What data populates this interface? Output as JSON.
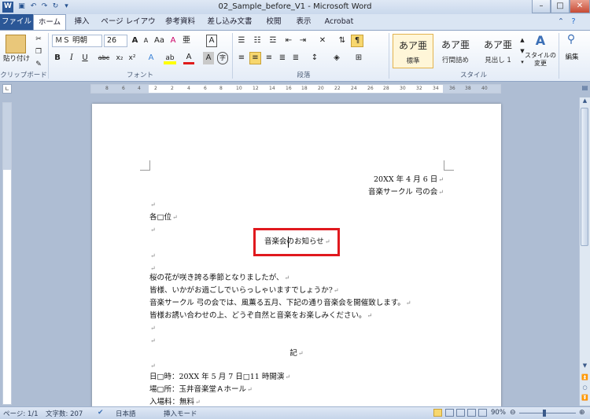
{
  "window": {
    "title": "02_Sample_before_V1 - Microsoft Word",
    "controls": {
      "minimize": "–",
      "maximize": "□",
      "close": "✕"
    },
    "qat_icons": [
      "word-logo-icon",
      "save-icon",
      "undo-icon",
      "redo-icon",
      "customize-qat-icon"
    ]
  },
  "tabs": [
    "ファイル",
    "ホーム",
    "挿入",
    "ページ レイアウト",
    "参考資料",
    "差し込み文書",
    "校閲",
    "表示",
    "Acrobat"
  ],
  "ribbon": {
    "clipboard": {
      "paste_label": "貼り付け",
      "group_label": "クリップボード"
    },
    "font": {
      "font_name": "ＭＳ 明朝",
      "font_size": "26",
      "group_label": "フォント",
      "buttons": [
        "A",
        "A",
        "Aa",
        "A",
        "亜",
        "A",
        "B",
        "I",
        "U",
        "abc",
        "x₂",
        "x²",
        "A",
        "ab",
        "A",
        "A",
        "字"
      ]
    },
    "paragraph": {
      "group_label": "段落"
    },
    "styles": {
      "items": [
        {
          "preview": "あア亜",
          "name": "標準"
        },
        {
          "preview": "あア亜",
          "name": "行間詰め"
        },
        {
          "preview": "あア亜",
          "name": "見出し 1"
        }
      ],
      "change_styles": "スタイルの変更",
      "group_label": "スタイル"
    },
    "editing": {
      "label": "編集"
    }
  },
  "ruler_numbers": [
    "8",
    "6",
    "4",
    "2",
    "2",
    "4",
    "6",
    "8",
    "10",
    "12",
    "14",
    "16",
    "18",
    "20",
    "22",
    "24",
    "26",
    "28",
    "30",
    "32",
    "34",
    "36",
    "38",
    "40"
  ],
  "document": {
    "date": "20XX 年 4 月 6 日",
    "sender": "音楽サークル 弓の会",
    "salutation": "各□位",
    "title": "音楽会のお知らせ",
    "body": [
      "桜の花が咲き誇る季節となりましたが、",
      "皆様、いかがお過ごしでいらっしゃいますでしょうか?",
      "音楽サークル 弓の会では、風薫る五月、下記の通り音楽会を開催致します。",
      "皆様お誘い合わせの上、どうぞ自然と音楽をお楽しみください。"
    ],
    "ki": "記",
    "details": [
      "日□時：20XX 年 5 月 7 日□11 時開演",
      "場□所：玉井音楽堂Ａホール",
      "入場料：無料"
    ],
    "paragraph_mark": "↵",
    "highlight_color": "#e0191e"
  },
  "statusbar": {
    "page": "ページ: 1/1",
    "words": "文字数: 207",
    "language": "日本語",
    "mode": "挿入モード",
    "zoom": "90%",
    "zoom_level": 0.9
  }
}
